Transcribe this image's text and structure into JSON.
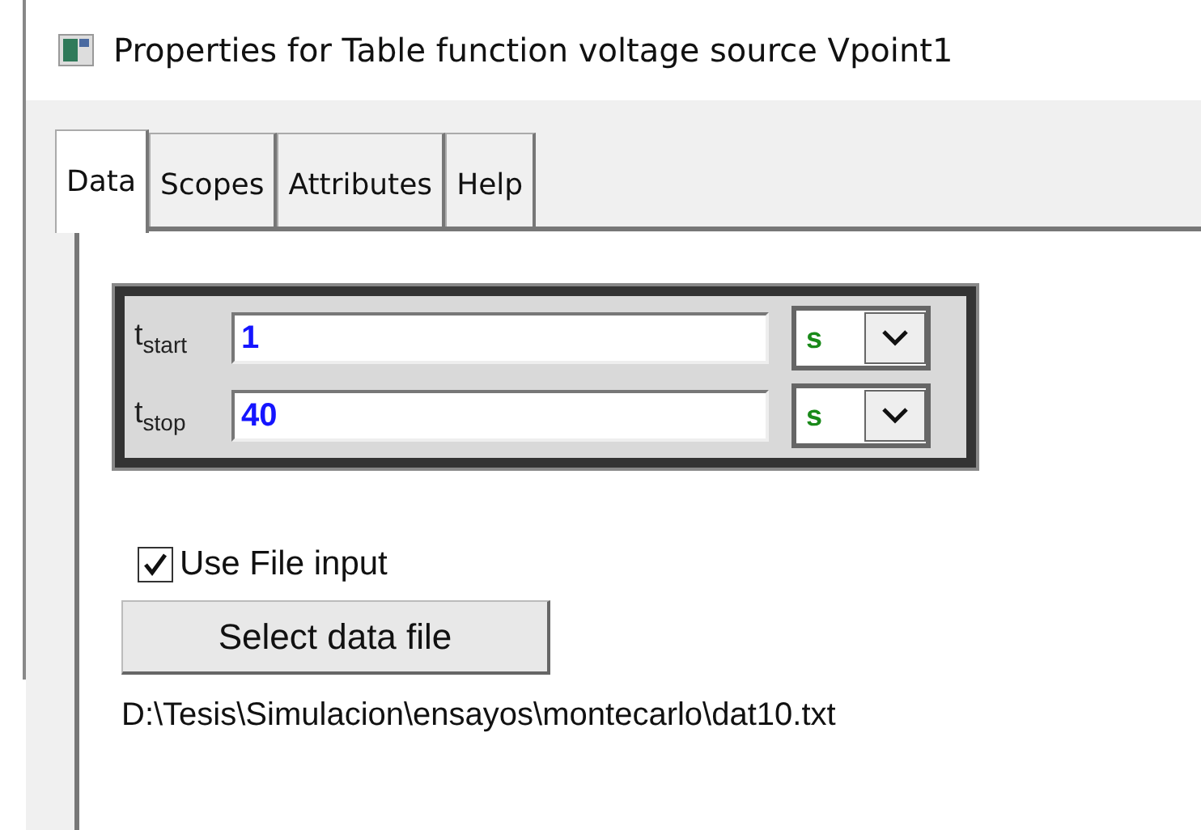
{
  "window": {
    "title": "Properties for Table function voltage source Vpoint1"
  },
  "tabs": [
    {
      "label": "Data",
      "selected": true
    },
    {
      "label": "Scopes",
      "selected": false
    },
    {
      "label": "Attributes",
      "selected": false
    },
    {
      "label": "Help",
      "selected": false
    }
  ],
  "parameters": [
    {
      "label": "t$_{start}$",
      "value": "1",
      "unit": "s"
    },
    {
      "label": "t$_{stop}$",
      "value": "40",
      "unit": "s"
    }
  ],
  "use_file_input": {
    "label": "Use File input",
    "checked": true
  },
  "select_button": "Select data file",
  "file_path": "D:\\Tesis\\Simulacion\\ensayos\\montecarlo\\dat10.txt"
}
